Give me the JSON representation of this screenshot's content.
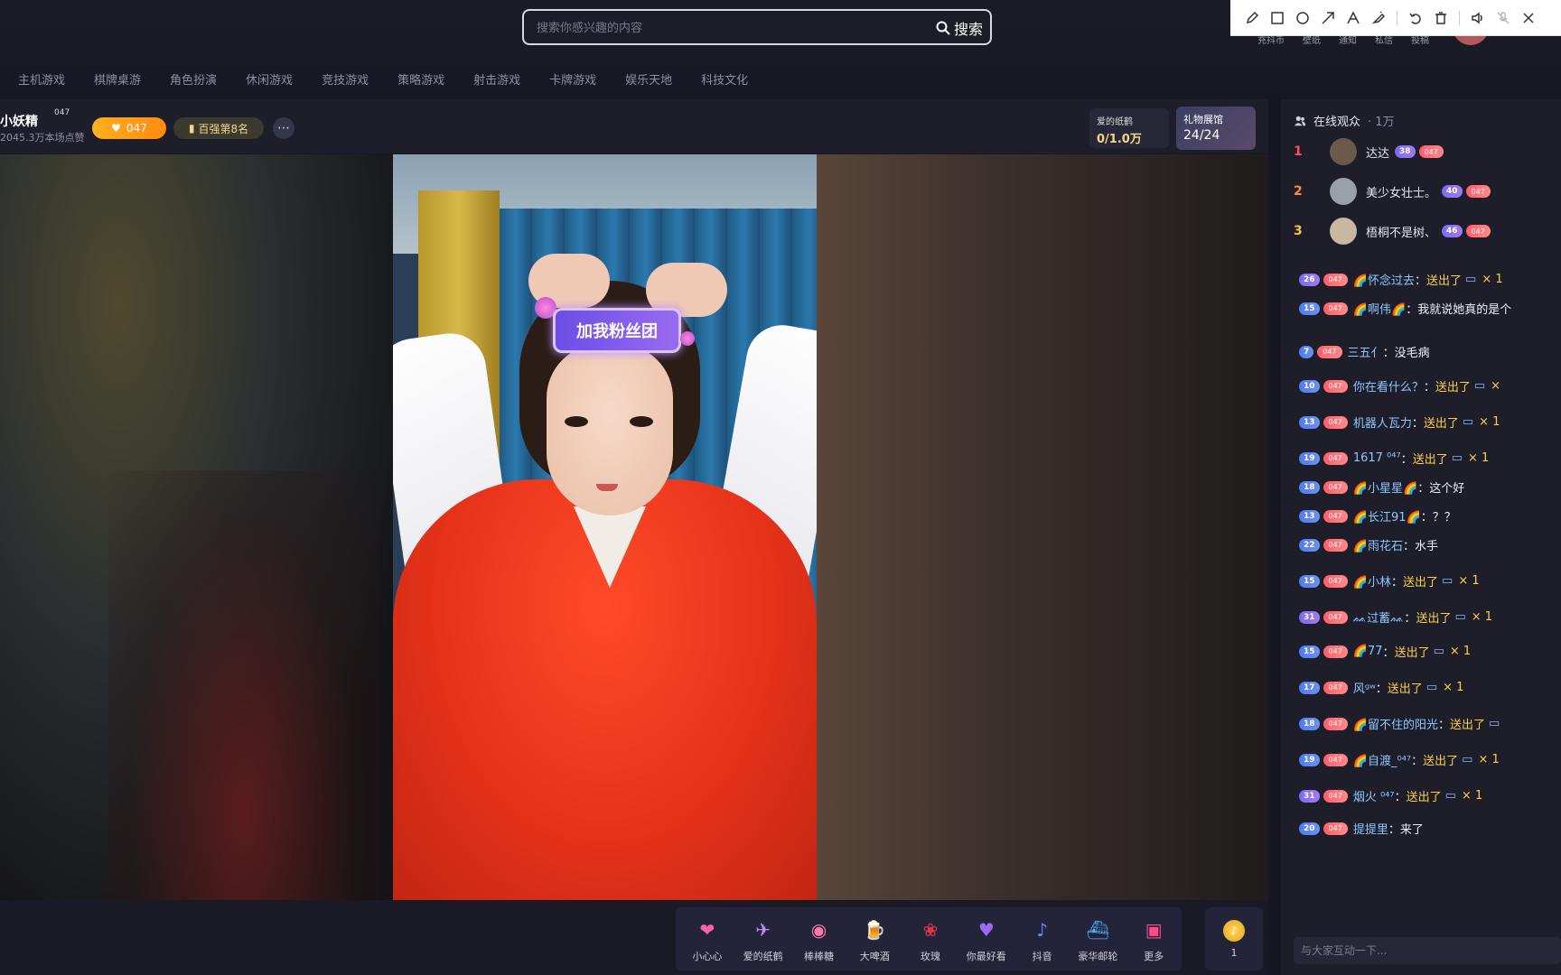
{
  "search": {
    "placeholder": "搜索你感兴趣的内容",
    "button_label": "搜索"
  },
  "categories": [
    "主机游戏",
    "棋牌桌游",
    "角色扮演",
    "休闲游戏",
    "竞技游戏",
    "策略游戏",
    "射击游戏",
    "卡牌游戏",
    "娱乐天地",
    "科技文化"
  ],
  "top_right": {
    "items": [
      "充抖币",
      "壁纸",
      "通知",
      "私信",
      "投稿"
    ]
  },
  "annotation_toolbar": {
    "tools": [
      "pencil-icon",
      "rectangle-icon",
      "circle-icon",
      "arrow-icon",
      "text-icon",
      "highlighter-icon",
      "undo-icon",
      "trash-icon",
      "speaker-icon",
      "mic-off-icon",
      "close-icon"
    ]
  },
  "streamer": {
    "name": "小妖精",
    "level": "047",
    "likes": "2045.3万本场点赞",
    "fan_badge": "047",
    "rank_badge": "百强第8名",
    "goal": {
      "title": "爱的纸鹤",
      "value": "0/1.0万"
    },
    "gallery": {
      "title": "礼物展馆",
      "value": "24/24"
    }
  },
  "video": {
    "sticker_text": "加我粉丝团"
  },
  "gifts": [
    {
      "label": "小心心",
      "icon": "heart-icon",
      "color": "#ff5fa8",
      "glyph": "❤"
    },
    {
      "label": "爱的纸鹤",
      "icon": "paper-crane-icon",
      "color": "#c58cf5",
      "glyph": "✈"
    },
    {
      "label": "棒棒糖",
      "icon": "lollipop-icon",
      "color": "#ff7aa8",
      "glyph": "◉"
    },
    {
      "label": "大啤酒",
      "icon": "beer-icon",
      "color": "#ffc23a",
      "glyph": "🍺"
    },
    {
      "label": "玫瑰",
      "icon": "rose-icon",
      "color": "#e8334a",
      "glyph": "❀"
    },
    {
      "label": "你最好看",
      "icon": "best-look-icon",
      "color": "#9a6bf0",
      "glyph": "♥"
    },
    {
      "label": "抖音",
      "icon": "douyin-icon",
      "color": "#5a8cff",
      "glyph": "♪"
    },
    {
      "label": "豪华邮轮",
      "icon": "cruise-ship-icon",
      "color": "#4fb0ff",
      "glyph": "⛴"
    },
    {
      "label": "更多",
      "icon": "gift-box-icon",
      "color": "#ff4a8a",
      "glyph": "▣"
    }
  ],
  "coins": {
    "value": "1"
  },
  "sidebar": {
    "title": "在线观众",
    "count": "· 1万",
    "ranking": [
      {
        "rank": "1",
        "name": "达达",
        "level": "38",
        "fan": "047",
        "rank_color": "#ff4d5e",
        "avatar_color": "#6a5a4a"
      },
      {
        "rank": "2",
        "name": "美少女壮士。",
        "level": "40",
        "fan": "047",
        "rank_color": "#ff8a3a",
        "avatar_color": "#9aa0a8"
      },
      {
        "rank": "3",
        "name": "梧桐不是树、",
        "level": "46",
        "fan": "047",
        "rank_color": "#f5c14a",
        "avatar_color": "#c8b8a0"
      }
    ],
    "chat": [
      {
        "level": "26",
        "fan": "047",
        "user": "🌈怀念过去",
        "text": "送出了",
        "gift": true,
        "count": "× 1",
        "lvl_class": "purple"
      },
      {
        "level": "15",
        "fan": "047",
        "user": "🌈啊伟🌈",
        "text": "我就说她真的是个",
        "gift": false,
        "count": "",
        "lvl_class": "blue"
      },
      {
        "level": "7",
        "fan": "047",
        "user": "三五亻",
        "text": "没毛病",
        "gift": false,
        "count": "",
        "lvl_class": "blue"
      },
      {
        "level": "10",
        "fan": "047",
        "user": "你在看什么？",
        "text": "送出了",
        "gift": true,
        "count": "×",
        "lvl_class": "blue"
      },
      {
        "level": "13",
        "fan": "047",
        "user": "机器人瓦力",
        "text": "送出了",
        "gift": true,
        "count": "× 1",
        "lvl_class": "blue"
      },
      {
        "level": "19",
        "fan": "047",
        "user": "1617 ⁰⁴⁷",
        "text": "送出了",
        "gift": true,
        "count": "× 1",
        "lvl_class": "blue"
      },
      {
        "level": "18",
        "fan": "047",
        "user": "🌈小星星🌈",
        "text": "这个好",
        "gift": false,
        "count": "",
        "lvl_class": "blue"
      },
      {
        "level": "13",
        "fan": "047",
        "user": "🌈长江91🌈",
        "text": "？？",
        "gift": false,
        "count": "",
        "lvl_class": "blue"
      },
      {
        "level": "22",
        "fan": "047",
        "user": "🌈雨花石",
        "text": "水手",
        "gift": false,
        "count": "",
        "lvl_class": "blue"
      },
      {
        "level": "15",
        "fan": "047",
        "user": "🌈小林",
        "text": "送出了",
        "gift": true,
        "count": "× 1",
        "lvl_class": "blue"
      },
      {
        "level": "31",
        "fan": "047",
        "user": "ᨐ过蓄ᨐ",
        "text": "送出了",
        "gift": true,
        "count": "× 1",
        "lvl_class": "purple"
      },
      {
        "level": "15",
        "fan": "047",
        "user": "🌈77",
        "text": "送出了",
        "gift": true,
        "count": "× 1",
        "lvl_class": "blue"
      },
      {
        "level": "17",
        "fan": "047",
        "user": "风ᵍʷ",
        "text": "送出了",
        "gift": true,
        "count": "× 1",
        "lvl_class": "blue"
      },
      {
        "level": "18",
        "fan": "047",
        "user": "🌈留不住的阳光",
        "text": "送出了",
        "gift": true,
        "count": "",
        "lvl_class": "blue"
      },
      {
        "level": "19",
        "fan": "047",
        "user": "🌈自渡_⁰⁴⁷",
        "text": "送出了",
        "gift": true,
        "count": "× 1",
        "lvl_class": "blue"
      },
      {
        "level": "31",
        "fan": "047",
        "user": "烟火 ⁰⁴⁷",
        "text": "送出了",
        "gift": true,
        "count": "× 1",
        "lvl_class": "purple"
      },
      {
        "level": "20",
        "fan": "047",
        "user": "提提里",
        "text": "来了",
        "gift": false,
        "count": "",
        "lvl_class": "blue"
      }
    ],
    "input_placeholder": "与大家互动一下..."
  }
}
